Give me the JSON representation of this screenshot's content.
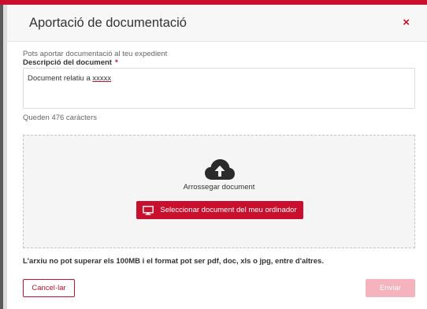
{
  "modal": {
    "title": "Aportació de documentació",
    "close_label": "×"
  },
  "form": {
    "intro": "Pots aportar documentació al teu expedient",
    "description_label": "Descripció del document",
    "required_marker": "*",
    "description_value_prefix": "Document relatiu a ",
    "description_value_suffix": "xxxxx",
    "chars_remaining": "Queden 476 caràcters"
  },
  "dropzone": {
    "icon": "cloud-upload-icon",
    "drag_text": "Arrossegar document",
    "select_button_icon": "monitor-icon",
    "select_button_label": "Seleccionar document del meu ordinador"
  },
  "limits_text": "L'arxiu no pot superar els 100MB i el format pot ser pdf, doc, xls o jpg, entre d'altres.",
  "footer": {
    "cancel_label": "Cancel·lar",
    "send_label": "Enviar",
    "send_enabled": false
  },
  "colors": {
    "accent": "#c8102e",
    "disabled_accent": "#f4b3bd"
  }
}
